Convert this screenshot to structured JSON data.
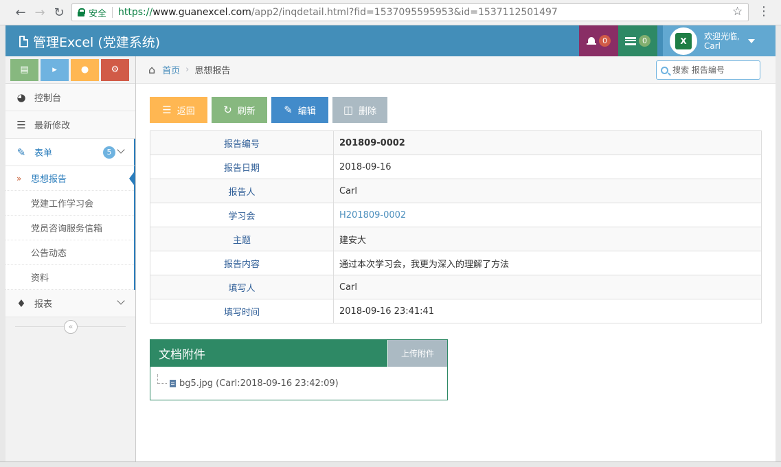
{
  "browser": {
    "secure_label": "安全",
    "url_scheme": "https://",
    "url_host": "www.guanexcel.com",
    "url_path": "/app2/inqdetail.html?fid=1537095595953&id=1537112501497"
  },
  "header": {
    "title": "管理Excel (党建系统)",
    "notifications_count": "0",
    "tasks_count": "0",
    "welcome": "欢迎光临,",
    "user_name": "Carl",
    "avatar_letter": "X"
  },
  "sidebar": {
    "items": [
      {
        "label": "控制台",
        "icon": "dashboard-icon"
      },
      {
        "label": "最新修改",
        "icon": "list-icon"
      },
      {
        "label": "表单",
        "icon": "edit-icon",
        "count": "5"
      },
      {
        "label": "报表",
        "icon": "tag-icon"
      }
    ],
    "submenu": [
      {
        "label": "思想报告",
        "active": true
      },
      {
        "label": "党建工作学习会"
      },
      {
        "label": "党员咨询服务信箱"
      },
      {
        "label": "公告动态"
      },
      {
        "label": "资料"
      }
    ]
  },
  "breadcrumb": {
    "home": "首页",
    "current": "思想报告"
  },
  "search": {
    "placeholder": "搜索 报告编号"
  },
  "toolbar": {
    "back": "返回",
    "refresh": "刷新",
    "edit": "编辑",
    "delete": "删除"
  },
  "detail": {
    "rows": [
      {
        "label": "报告编号",
        "value": "201809-0002"
      },
      {
        "label": "报告日期",
        "value": "2018-09-16"
      },
      {
        "label": "报告人",
        "value": "Carl"
      },
      {
        "label": "学习会",
        "value": "H201809-0002"
      },
      {
        "label": "主题",
        "value": "建安大"
      },
      {
        "label": "报告内容",
        "value": "通过本次学习会，我更为深入的理解了方法"
      },
      {
        "label": "填写人",
        "value": "Carl"
      },
      {
        "label": "填写时间",
        "value": "2018-09-16 23:41:41"
      }
    ]
  },
  "attachments": {
    "title": "文档附件",
    "upload": "上传附件",
    "file": "bg5.jpg (Carl:2018-09-16 23:42:09)"
  },
  "colors": {
    "header": "#438eb9",
    "notif": "#892e65",
    "tasks": "#2e8965",
    "user": "#62a8d1",
    "attach_head": "#2e8965"
  }
}
